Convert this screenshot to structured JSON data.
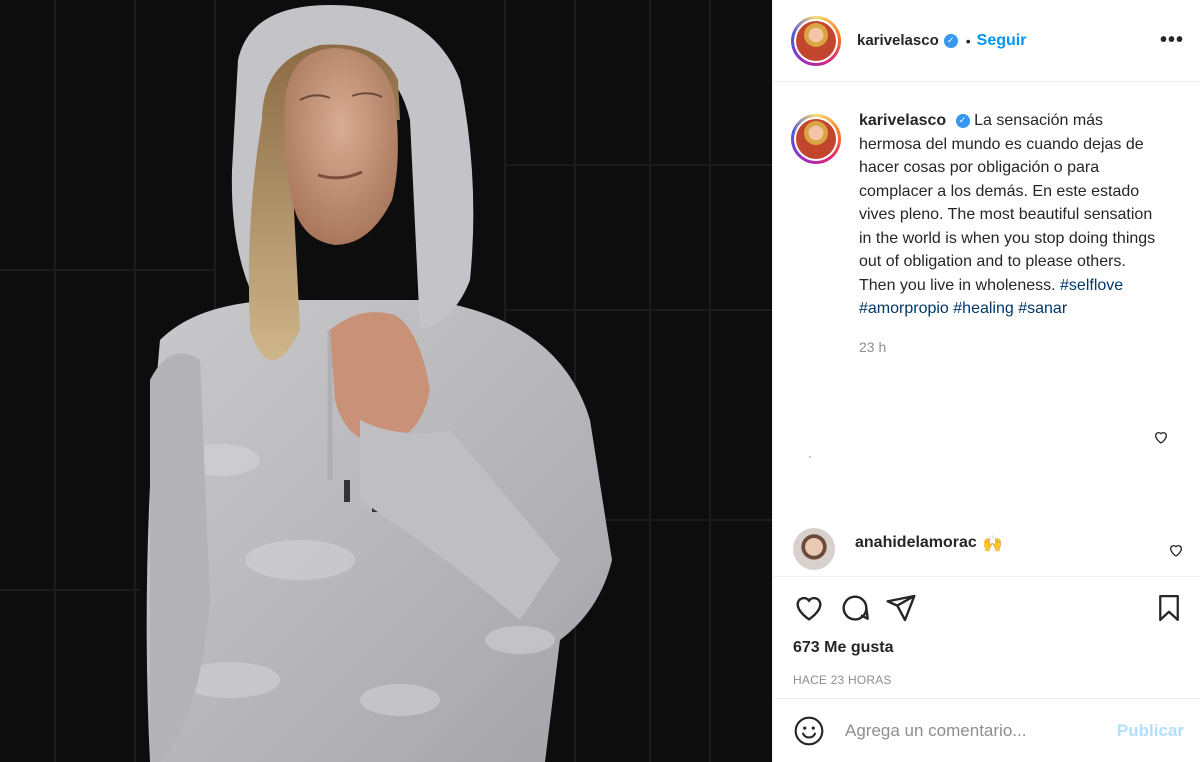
{
  "post": {
    "username": "karivelasco",
    "separator": "•",
    "follow_label": "Seguir",
    "more_label": "•••",
    "caption": {
      "username": "karivelasco",
      "text": "La sensación más hermosa del mundo es cuando dejas de hacer cosas por obligación o para complacer a los demás. En este estado vives pleno. The most beautiful sensation in the world is when you stop doing things out of obligation and to please others. Then you live in wholeness.",
      "hashtags": [
        "#selflove",
        "#amorpropio",
        "#healing",
        "#sanar"
      ],
      "time": "23 h"
    },
    "comments": [
      {
        "username": "anahidelamorac",
        "text": "🙌"
      }
    ],
    "likes": "673 Me gusta",
    "posted_ago": "HACE 23 HORAS",
    "comment_input": {
      "placeholder": "Agrega un comentario...",
      "publish_label": "Publicar"
    }
  },
  "colors": {
    "link": "#0095f6",
    "hashtag": "#00376b",
    "muted": "#8e8e8e",
    "publish_disabled": "#b2dffc",
    "verified": "#3897f0"
  },
  "icons": [
    "verified-badge-icon",
    "more-options-icon",
    "heart-icon",
    "comment-icon",
    "share-icon",
    "bookmark-icon",
    "emoji-icon"
  ]
}
